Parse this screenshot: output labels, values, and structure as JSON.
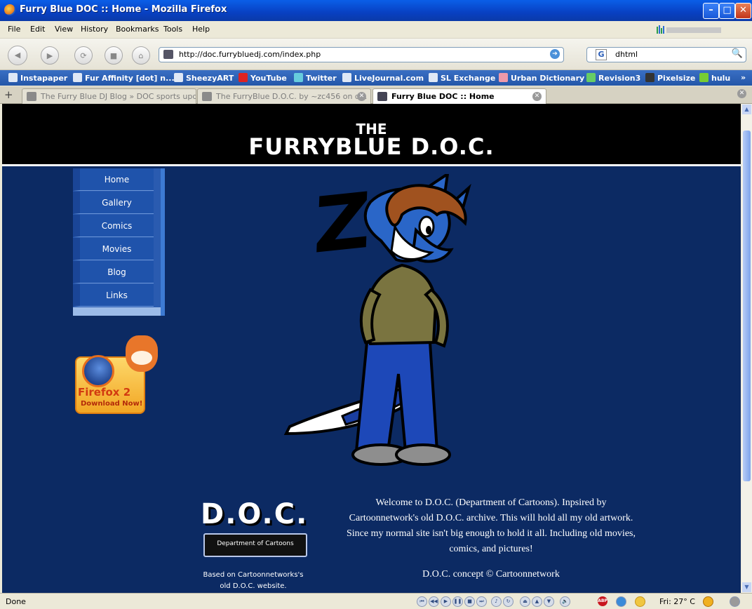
{
  "window": {
    "title": "Furry Blue DOC :: Home - Mozilla Firefox",
    "minimize": "–",
    "maximize": "□",
    "close": "✕"
  },
  "menu": [
    "File",
    "Edit",
    "View",
    "History",
    "Bookmarks",
    "Tools",
    "Help"
  ],
  "nav": {
    "url": "http://doc.furrybluedj.com/index.php",
    "search": "dhtml",
    "search_engine": "G"
  },
  "bookmarks": [
    "Instapaper",
    "Fur Affinity [dot] n...",
    "SheezyART",
    "YouTube",
    "Twitter",
    "LiveJournal.com",
    "SL Exchange",
    "Urban Dictionary",
    "Revision3",
    "Pixelsize",
    "hulu"
  ],
  "tabs": [
    {
      "label": "The Furry Blue DJ Blog » DOC sports upd...",
      "active": false
    },
    {
      "label": "The FurryBlue D.O.C. by ~zc456 on d...",
      "active": false
    },
    {
      "label": "Furry Blue DOC :: Home",
      "active": true
    }
  ],
  "site": {
    "logo_the": "THE",
    "logo_main": "FURRYBLUE D.O.C.",
    "sidebar": [
      "Home",
      "Gallery",
      "Comics",
      "Movies",
      "Blog",
      "Links"
    ],
    "firefox_badge": {
      "line1": "Firefox 2",
      "line2": "Download Now!"
    },
    "zzz": "Z",
    "doc_logo": {
      "big": "D.O.C.",
      "tag": "Department of Cartoons"
    },
    "based_on": [
      "Based on Cartoonnetworks's",
      "old D.O.C. website."
    ],
    "welcome": [
      "Welcome to D.O.C. (Department of Cartoons). Inpsired by",
      "Cartoonnetwork's old D.O.C. archive. This will hold all my old artwork.",
      "Since my normal site isn't big enough to hold it all. Including old movies,",
      "comics, and pictures!"
    ],
    "concept": "D.O.C. concept © Cartoonnetwork"
  },
  "status": {
    "text": "Done",
    "weather": "Fri: 27° C",
    "adblock": "ABP"
  },
  "colors": {
    "page_bg": "#0c2a63",
    "nav_bg": "#1f53ab",
    "header_bg": "#000000"
  }
}
